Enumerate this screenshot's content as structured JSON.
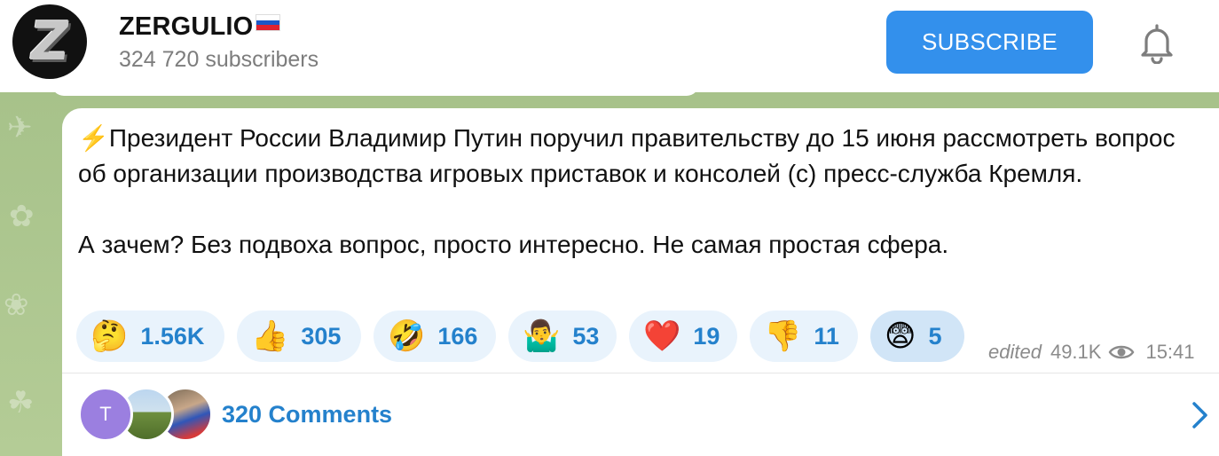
{
  "header": {
    "channel_name": "ZERGULIO",
    "subscribers": "324 720 subscribers",
    "subscribe_label": "SUBSCRIBE",
    "avatar_letter": "Z",
    "bell_icon": "bell-icon"
  },
  "message": {
    "lightning": "⚡",
    "paragraph1": "Президент России Владимир Путин поручил правительству до 15 июня рассмотреть вопрос об организации производства игровых приставок и консолей (с) пресс-служба Кремля.",
    "paragraph2": "А зачем? Без подвоха вопрос, просто интересно. Не самая простая сфера.",
    "reactions": [
      {
        "emoji": "🤔",
        "count": "1.56K"
      },
      {
        "emoji": "👍",
        "count": "305"
      },
      {
        "emoji": "🤣",
        "count": "166"
      },
      {
        "emoji": "🤷‍♂️",
        "count": "53"
      },
      {
        "emoji": "❤️",
        "count": "19"
      },
      {
        "emoji": "👎",
        "count": "11"
      },
      {
        "emoji": "😨",
        "count": "5"
      }
    ],
    "edited_label": "edited",
    "views": "49.1K",
    "time": "15:41"
  },
  "comments": {
    "avatar_letter": "T",
    "label": "320 Comments"
  },
  "colors": {
    "accent": "#3390ec",
    "link": "#2481cc",
    "reaction_bg": "#e9f3fc"
  }
}
